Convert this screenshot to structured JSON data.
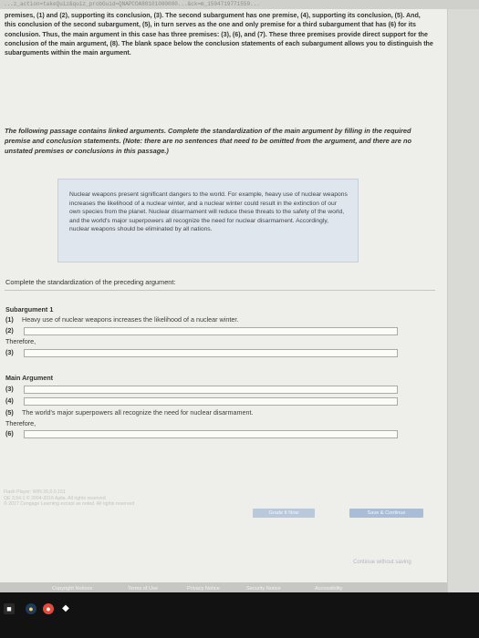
{
  "browser": {
    "url": "...z_action=takeQuiz&quiz_probGuid=QNAPCOA80101000000...&ck=m_1504719771559..."
  },
  "intro": "premises, (1) and (2), supporting its conclusion, (3). The second subargument has one premise, (4), supporting its conclusion, (5). And, this conclusion of the second subargument, (5), in turn serves as the one and only premise for a third subargument that has (6) for its conclusion. Thus, the main argument in this case has three premises: (3), (6), and (7). These three premises provide direct support for the conclusion of the main argument, (8). The blank space below the conclusion statements of each subargument allows you to distinguish the subarguments within the main argument.",
  "instructions": "The following passage contains linked arguments. Complete the standardization of the main argument by filling in the required premise and conclusion statements. (Note: there are no sentences that need to be omitted from the argument, and there are no unstated premises or conclusions in this passage.)",
  "passage": "Nuclear weapons present significant dangers to the world. For example, heavy use of nuclear weapons increases the likelihood of a nuclear winter, and a nuclear winter could result in the extinction of our own species from the planet. Nuclear disarmament will reduce these threats to the safety of the world, and the world's major superpowers all recognize the need for nuclear disarmament. Accordingly, nuclear weapons should be eliminated by all nations.",
  "prompt": "Complete the standardization of the preceding argument:",
  "sub1": {
    "title": "Subargument 1",
    "n1": "(1)",
    "s1": "Heavy use of nuclear weapons increases the likelihood of a nuclear winter.",
    "n2": "(2)",
    "therefore": "Therefore,",
    "n3": "(3)"
  },
  "main": {
    "title": "Main Argument",
    "n3": "(3)",
    "n4": "(4)",
    "n5": "(5)",
    "s5": "The world's major superpowers all recognize the need for nuclear disarmament.",
    "therefore": "Therefore,",
    "n6": "(6)"
  },
  "watermark": {
    "l1": "Flash Player: WIN 26,0,0,151",
    "l2": "QE 3.54.1 © 2004-2016 Aplia. All rights reserved",
    "l3": "© 2017 Cengage Learning except as noted. All rights reserved"
  },
  "buttons": {
    "grade": "Grade It Now",
    "save": "Save & Continue"
  },
  "continue_link": "Continue without saving",
  "footer": {
    "copyright": "Copyright Notices",
    "terms": "Terms of Use",
    "privacy": "Privacy Notice",
    "security": "Security Notice",
    "accessibility": "Accessibility"
  },
  "taskbar": {
    "icons": [
      "app-icon",
      "chrome-icon",
      "firefox-icon",
      "dropbox-icon"
    ]
  },
  "colors": {
    "page_bg": "#eeeeea",
    "passage_bg": "#dfe6ee",
    "button_blue": "#aabdd6"
  }
}
